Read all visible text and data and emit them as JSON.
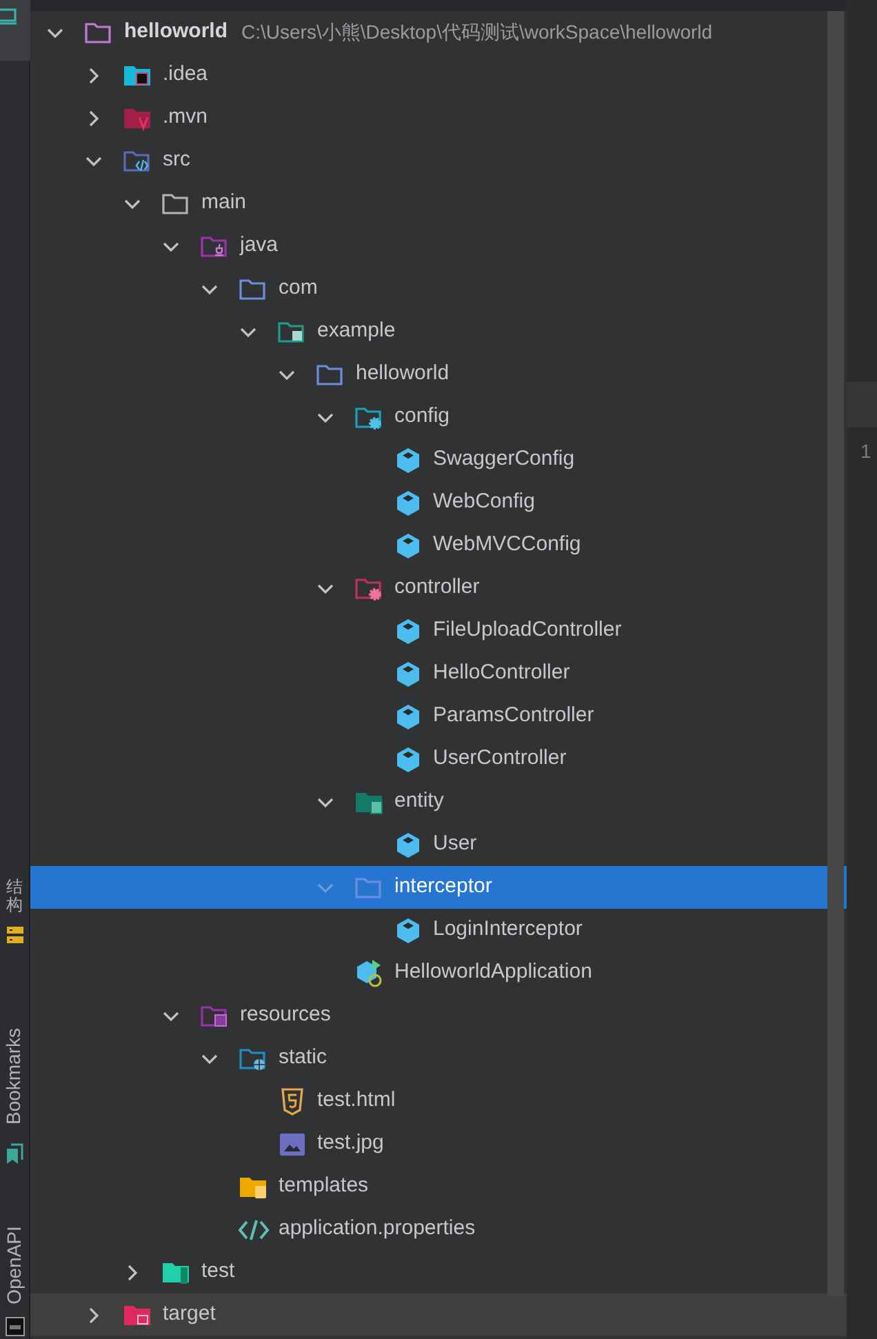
{
  "side_strip": {
    "tabs": [
      {
        "label": "结构",
        "kind": "structure"
      },
      {
        "label": "Bookmarks",
        "kind": "bookmarks"
      },
      {
        "label": "OpenAPI",
        "kind": "openapi"
      }
    ]
  },
  "tree": [
    {
      "name": "helloworld",
      "path": "C:\\Users\\小熊\\Desktop\\代码测试\\workSpace\\helloworld",
      "kind": "module",
      "expanded": true,
      "selected": false,
      "hovered": false,
      "children": [
        {
          "name": ".idea",
          "kind": "idea",
          "expanded": false,
          "selected": false,
          "hovered": false
        },
        {
          "name": ".mvn",
          "kind": "mvn",
          "expanded": false,
          "selected": false,
          "hovered": false
        },
        {
          "name": "src",
          "kind": "src",
          "expanded": true,
          "selected": false,
          "hovered": false,
          "children": [
            {
              "name": "main",
              "kind": "folder",
              "expanded": true,
              "selected": false,
              "hovered": false,
              "children": [
                {
                  "name": "java",
                  "kind": "java",
                  "expanded": true,
                  "selected": false,
                  "hovered": false,
                  "children": [
                    {
                      "name": "com",
                      "kind": "package",
                      "expanded": true,
                      "selected": false,
                      "hovered": false,
                      "children": [
                        {
                          "name": "example",
                          "kind": "example",
                          "expanded": true,
                          "selected": false,
                          "hovered": false,
                          "children": [
                            {
                              "name": "helloworld",
                              "kind": "package",
                              "expanded": true,
                              "selected": false,
                              "hovered": false,
                              "children": [
                                {
                                  "name": "config",
                                  "kind": "config",
                                  "expanded": true,
                                  "selected": false,
                                  "hovered": false,
                                  "children": [
                                    {
                                      "name": "SwaggerConfig",
                                      "kind": "class",
                                      "selected": false,
                                      "hovered": false
                                    },
                                    {
                                      "name": "WebConfig",
                                      "kind": "class",
                                      "selected": false,
                                      "hovered": false
                                    },
                                    {
                                      "name": "WebMVCConfig",
                                      "kind": "class",
                                      "selected": false,
                                      "hovered": false
                                    }
                                  ]
                                },
                                {
                                  "name": "controller",
                                  "kind": "controller",
                                  "expanded": true,
                                  "selected": false,
                                  "hovered": false,
                                  "children": [
                                    {
                                      "name": "FileUploadController",
                                      "kind": "class",
                                      "selected": false,
                                      "hovered": false
                                    },
                                    {
                                      "name": "HelloController",
                                      "kind": "class",
                                      "selected": false,
                                      "hovered": false
                                    },
                                    {
                                      "name": "ParamsController",
                                      "kind": "class",
                                      "selected": false,
                                      "hovered": false
                                    },
                                    {
                                      "name": "UserController",
                                      "kind": "class",
                                      "selected": false,
                                      "hovered": false
                                    }
                                  ]
                                },
                                {
                                  "name": "entity",
                                  "kind": "entity",
                                  "expanded": true,
                                  "selected": false,
                                  "hovered": false,
                                  "children": [
                                    {
                                      "name": "User",
                                      "kind": "class",
                                      "selected": false,
                                      "hovered": false
                                    }
                                  ]
                                },
                                {
                                  "name": "interceptor",
                                  "kind": "package",
                                  "expanded": true,
                                  "selected": true,
                                  "hovered": false,
                                  "children": [
                                    {
                                      "name": "LoginInterceptor",
                                      "kind": "class",
                                      "selected": false,
                                      "hovered": false
                                    }
                                  ]
                                },
                                {
                                  "name": "HelloworldApplication",
                                  "kind": "app",
                                  "selected": false,
                                  "hovered": false
                                }
                              ]
                            }
                          ]
                        }
                      ]
                    }
                  ]
                },
                {
                  "name": "resources",
                  "kind": "resources",
                  "expanded": true,
                  "selected": false,
                  "hovered": false,
                  "children": [
                    {
                      "name": "static",
                      "kind": "static",
                      "expanded": true,
                      "selected": false,
                      "hovered": false,
                      "children": [
                        {
                          "name": "test.html",
                          "kind": "html",
                          "selected": false,
                          "hovered": false
                        },
                        {
                          "name": "test.jpg",
                          "kind": "image",
                          "selected": false,
                          "hovered": false
                        }
                      ]
                    },
                    {
                      "name": "templates",
                      "kind": "templates",
                      "selected": false,
                      "hovered": false
                    },
                    {
                      "name": "application.properties",
                      "kind": "properties",
                      "selected": false,
                      "hovered": false
                    }
                  ]
                }
              ]
            },
            {
              "name": "test",
              "kind": "test",
              "expanded": false,
              "selected": false,
              "hovered": false
            }
          ]
        },
        {
          "name": "target",
          "kind": "target",
          "expanded": false,
          "selected": false,
          "hovered": true
        }
      ]
    }
  ],
  "editor": {
    "line_numbers": [
      "1"
    ]
  }
}
